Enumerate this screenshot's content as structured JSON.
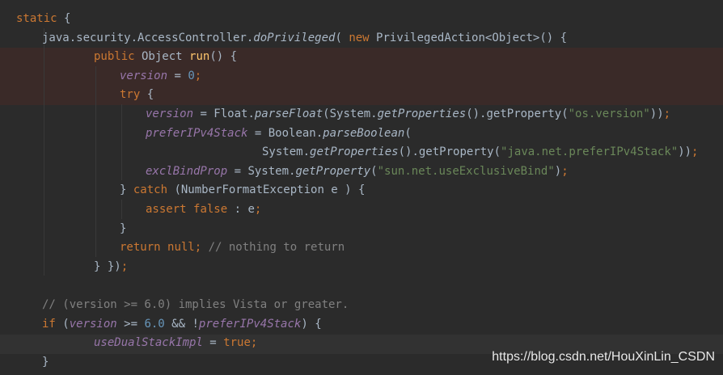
{
  "colors": {
    "background": "#2b2b2b",
    "keyword": "#cc7832",
    "field": "#9876aa",
    "number": "#6897bb",
    "string": "#6a8759",
    "comment": "#808080",
    "method_declaration": "#ffc66d",
    "plain": "#a9b7c6"
  },
  "lines": [
    {
      "tokens": [
        {
          "t": "static",
          "c": "kw"
        },
        {
          "t": " {"
        }
      ]
    },
    {
      "tokens": [
        {
          "t": "java.security.AccessController."
        },
        {
          "t": "doPrivileged",
          "c": "st"
        },
        {
          "t": "( "
        },
        {
          "t": "new",
          "c": "kw"
        },
        {
          "t": " PrivilegedAction<Object>() {"
        }
      ]
    },
    {
      "tokens": [
        {
          "t": "public",
          "c": "kw"
        },
        {
          "t": " Object "
        },
        {
          "t": "run",
          "c": "mth"
        },
        {
          "t": "() {"
        }
      ]
    },
    {
      "tokens": [
        {
          "t": "version",
          "c": "fld"
        },
        {
          "t": " = "
        },
        {
          "t": "0",
          "c": "num"
        },
        {
          "t": ";",
          "c": "kw"
        }
      ]
    },
    {
      "tokens": [
        {
          "t": "try",
          "c": "kw"
        },
        {
          "t": " {"
        }
      ]
    },
    {
      "tokens": [
        {
          "t": "version",
          "c": "fld"
        },
        {
          "t": " = Float."
        },
        {
          "t": "parseFloat",
          "c": "st"
        },
        {
          "t": "(System."
        },
        {
          "t": "getProperties",
          "c": "st"
        },
        {
          "t": "().getProperty("
        },
        {
          "t": "\"os.version\"",
          "c": "str"
        },
        {
          "t": "))"
        },
        {
          "t": ";",
          "c": "kw"
        }
      ]
    },
    {
      "tokens": [
        {
          "t": "preferIPv4Stack",
          "c": "fld"
        },
        {
          "t": " = Boolean."
        },
        {
          "t": "parseBoolean",
          "c": "st"
        },
        {
          "t": "("
        }
      ]
    },
    {
      "tokens": [
        {
          "t": "System."
        },
        {
          "t": "getProperties",
          "c": "st"
        },
        {
          "t": "().getProperty("
        },
        {
          "t": "\"java.net.preferIPv4Stack\"",
          "c": "str"
        },
        {
          "t": "))"
        },
        {
          "t": ";",
          "c": "kw"
        }
      ]
    },
    {
      "tokens": [
        {
          "t": "exclBindProp",
          "c": "fld"
        },
        {
          "t": " = System."
        },
        {
          "t": "getProperty",
          "c": "st"
        },
        {
          "t": "("
        },
        {
          "t": "\"sun.net.useExclusiveBind\"",
          "c": "str"
        },
        {
          "t": ")"
        },
        {
          "t": ";",
          "c": "kw"
        }
      ]
    },
    {
      "tokens": [
        {
          "t": "} "
        },
        {
          "t": "catch",
          "c": "kw"
        },
        {
          "t": " (NumberFormatException e ) {"
        }
      ]
    },
    {
      "tokens": [
        {
          "t": "assert",
          "c": "kw"
        },
        {
          "t": " "
        },
        {
          "t": "false",
          "c": "kw"
        },
        {
          "t": " : e"
        },
        {
          "t": ";",
          "c": "kw"
        }
      ]
    },
    {
      "tokens": [
        {
          "t": "}"
        }
      ]
    },
    {
      "tokens": [
        {
          "t": "return",
          "c": "kw"
        },
        {
          "t": " "
        },
        {
          "t": "null",
          "c": "kw"
        },
        {
          "t": "; ",
          "c": "kw"
        },
        {
          "t": "// nothing to return",
          "c": "cmt"
        }
      ]
    },
    {
      "tokens": [
        {
          "t": "} })"
        },
        {
          "t": ";",
          "c": "kw"
        }
      ]
    },
    {
      "tokens": []
    },
    {
      "tokens": [
        {
          "t": "// (version >= 6.0) implies Vista or greater.",
          "c": "cmt"
        }
      ]
    },
    {
      "tokens": [
        {
          "t": "if",
          "c": "kw"
        },
        {
          "t": " ("
        },
        {
          "t": "version",
          "c": "fld"
        },
        {
          "t": " >= "
        },
        {
          "t": "6.0",
          "c": "num"
        },
        {
          "t": " && !"
        },
        {
          "t": "preferIPv4Stack",
          "c": "fld"
        },
        {
          "t": ") {"
        }
      ]
    },
    {
      "tokens": [
        {
          "t": "useDualStackImpl",
          "c": "fld"
        },
        {
          "t": " = "
        },
        {
          "t": "true",
          "c": "kw"
        },
        {
          "t": ";",
          "c": "kw"
        }
      ]
    },
    {
      "tokens": [
        {
          "t": "}"
        }
      ]
    }
  ],
  "watermark": "https://blog.csdn.net/HouXinLin_CSDN"
}
